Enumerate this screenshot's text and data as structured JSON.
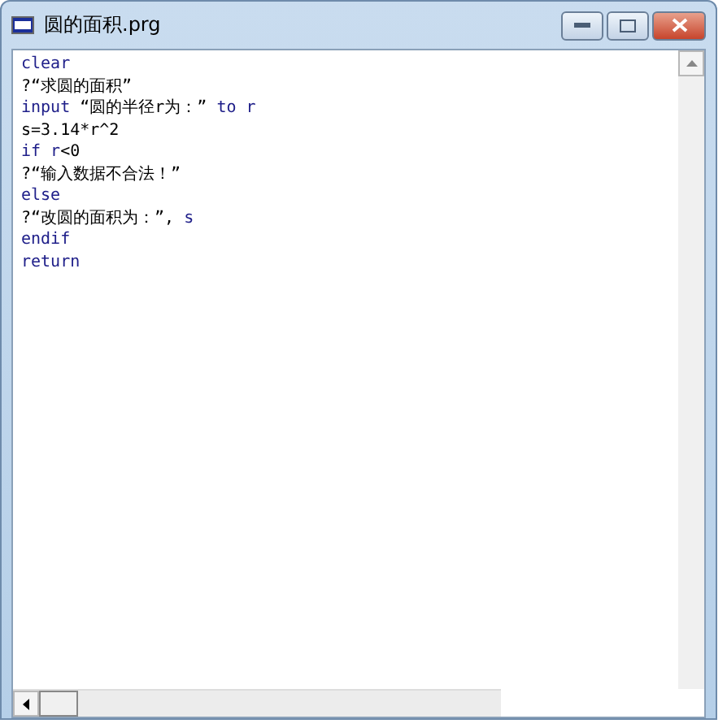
{
  "window": {
    "title": "圆的面积.prg"
  },
  "code_lines": [
    [
      {
        "kind": "keyword",
        "text": "clear"
      }
    ],
    [
      {
        "kind": "text",
        "text": "?“求圆的面积”"
      }
    ],
    [
      {
        "kind": "keyword",
        "text": "input "
      },
      {
        "kind": "text",
        "text": "“圆的半径r为：” "
      },
      {
        "kind": "keyword",
        "text": "to r"
      }
    ],
    [
      {
        "kind": "text",
        "text": "s=3.14*r^2"
      }
    ],
    [
      {
        "kind": "keyword",
        "text": "if r"
      },
      {
        "kind": "text",
        "text": "<0"
      }
    ],
    [
      {
        "kind": "text",
        "text": "?“输入数据不合法！”"
      }
    ],
    [
      {
        "kind": "keyword",
        "text": "else"
      }
    ],
    [
      {
        "kind": "text",
        "text": "?“改圆的面积为：”, "
      },
      {
        "kind": "keyword",
        "text": "s"
      }
    ],
    [
      {
        "kind": "keyword",
        "text": "endif"
      }
    ],
    [
      {
        "kind": "keyword",
        "text": "return"
      }
    ]
  ]
}
